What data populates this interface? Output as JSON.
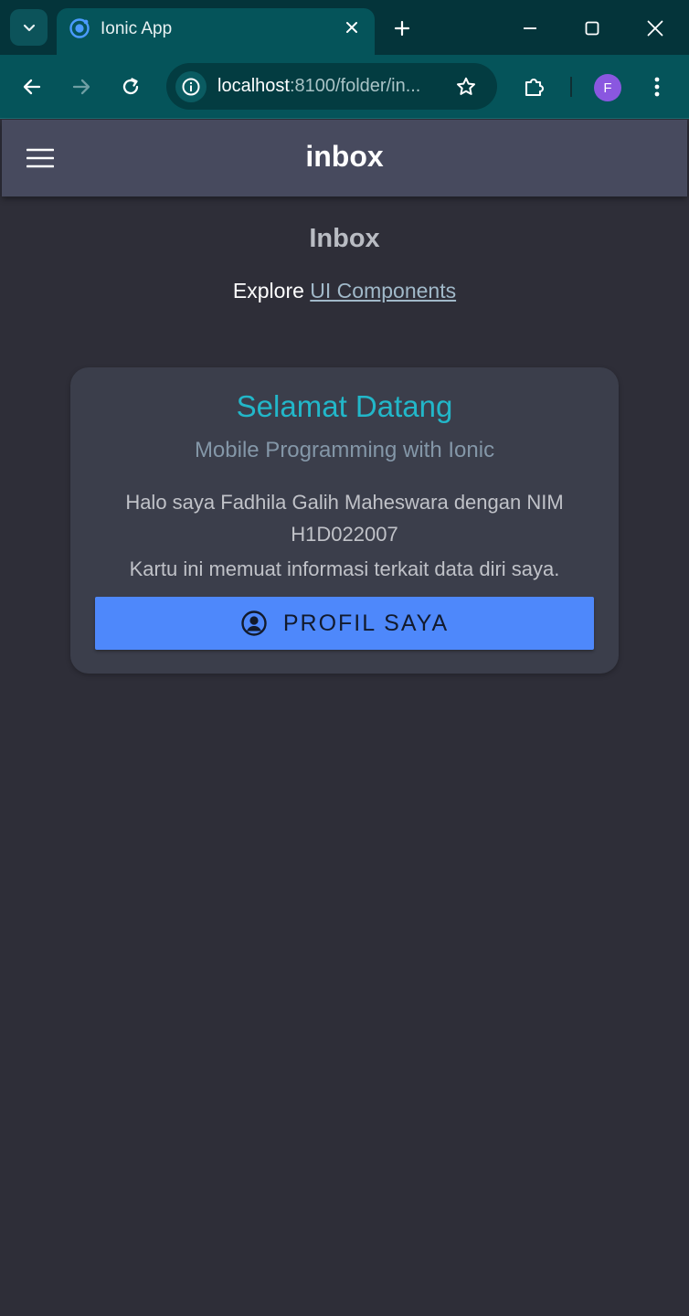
{
  "browser": {
    "tab": {
      "title": "Ionic App",
      "favicon": "ionic-logo-icon"
    },
    "address_bar": {
      "host": "localhost",
      "path": ":8100/folder/in..."
    },
    "profile_initial": "F",
    "colors": {
      "tab_strip": "#04343a",
      "toolbar": "#05545a",
      "avatar": "#8a57e0"
    },
    "icons": [
      "chevron-down-icon",
      "close-icon",
      "plus-icon",
      "minimize-icon",
      "maximize-icon",
      "close-window-icon",
      "back-arrow-icon",
      "forward-arrow-icon",
      "reload-icon",
      "site-info-icon",
      "star-icon",
      "extensions-icon",
      "kebab-menu-icon"
    ]
  },
  "app": {
    "header": {
      "title": "inbox",
      "menu_icon": "hamburger-menu-icon"
    },
    "content": {
      "heading": "Inbox",
      "explore_text": "Explore",
      "explore_link": "UI Components"
    },
    "card": {
      "title": "Selamat Datang",
      "subtitle": "Mobile Programming with Ionic",
      "body_line_1": "Halo saya Fadhila Galih Maheswara dengan NIM H1D022007",
      "body_line_2": "Kartu ini memuat informasi terkait data diri saya.",
      "button_label": "PROFIL SAYA",
      "button_icon": "person-circle-icon"
    },
    "colors": {
      "background": "#2e2e38",
      "header": "#474a5e",
      "card": "#3b3e4b",
      "card_title": "#22b7c9",
      "button": "#4e88fb"
    }
  }
}
